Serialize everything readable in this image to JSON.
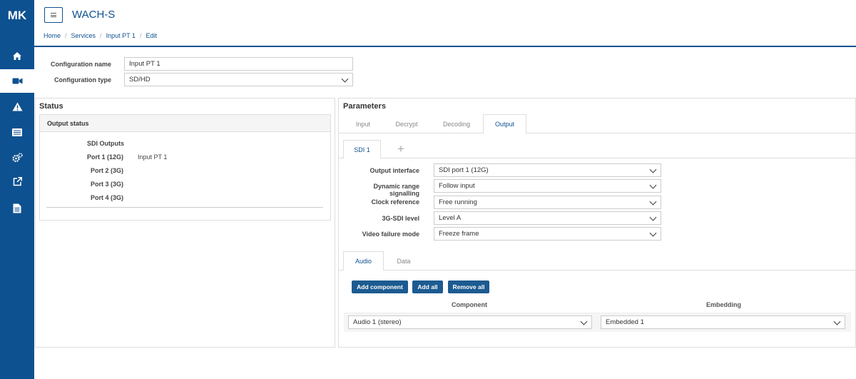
{
  "app": {
    "logo": "MK",
    "title": "WACH-S"
  },
  "breadcrumb": [
    "Home",
    "Services",
    "Input PT 1",
    "Edit"
  ],
  "config": {
    "name_label": "Configuration name",
    "name_value": "Input PT 1",
    "type_label": "Configuration type",
    "type_value": "SD/HD"
  },
  "status": {
    "title": "Status",
    "subtitle": "Output status",
    "outputs_heading": "SDI Outputs",
    "ports": [
      {
        "label": "Port 1 (12G)",
        "value": "Input PT 1"
      },
      {
        "label": "Port 2 (3G)",
        "value": ""
      },
      {
        "label": "Port 3 (3G)",
        "value": ""
      },
      {
        "label": "Port 4 (3G)",
        "value": ""
      }
    ]
  },
  "parameters": {
    "title": "Parameters",
    "tabs": [
      "Input",
      "Decrypt",
      "Decoding",
      "Output"
    ],
    "active_tab": "Output",
    "sdi_tab": "SDI 1",
    "add_tab_symbol": "+",
    "fields": [
      {
        "label": "Output interface",
        "value": "SDI port 1 (12G)"
      },
      {
        "label": "Dynamic range signalling",
        "value": "Follow input"
      },
      {
        "label": "Clock reference",
        "value": "Free running"
      },
      {
        "label": "3G-SDI level",
        "value": "Level A"
      },
      {
        "label": "Video failure mode",
        "value": "Freeze frame"
      }
    ],
    "sub_tabs": [
      "Audio",
      "Data"
    ],
    "buttons": {
      "add_component": "Add component",
      "add_all": "Add all",
      "remove_all": "Remove all"
    },
    "columns": {
      "component": "Component",
      "embedding": "Embedding"
    },
    "audio_row": {
      "component": "Audio 1 (stereo)",
      "embedding": "Embedded 1"
    }
  },
  "colors": {
    "brand": "#0e5190",
    "button": "#1c5b91"
  },
  "icons": [
    "home-icon",
    "video-camera-icon",
    "warning-icon",
    "list-icon",
    "cogs-icon",
    "external-link-icon",
    "document-icon"
  ]
}
